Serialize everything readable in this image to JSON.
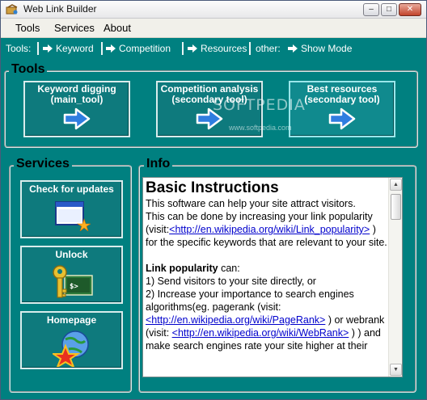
{
  "window": {
    "title": "Web Link Builder",
    "controls": {
      "minimize": "–",
      "maximize": "□",
      "close": "✕"
    }
  },
  "menu": [
    "Tools",
    "Services",
    "About"
  ],
  "toolbar": {
    "tools_label": "Tools:",
    "keyword": "Keyword",
    "competition": "Competition",
    "resources": "Resources",
    "other_label": "other:",
    "show_mode": "Show Mode"
  },
  "tools_group": {
    "title": "Tools",
    "buttons": [
      {
        "line1": "Keyword digging",
        "line2": "(main_tool)"
      },
      {
        "line1": "Competition analysis",
        "line2": "(secondary tool)"
      },
      {
        "line1": "Best resources",
        "line2": "(secondary tool)"
      }
    ]
  },
  "services_group": {
    "title": "Services",
    "buttons": [
      "Check for updates",
      "Unlock",
      "Homepage"
    ]
  },
  "info_group": {
    "title": "Info",
    "heading": "Basic Instructions",
    "para1_a": "This software can help your site attract visitors.",
    "para1_b": " This can be done by increasing your link popularity (visit:",
    "link1": "<http://en.wikipedia.org/wiki/Link_popularity>",
    "para1_c": " ) for the specific keywords that are relevant to your site.",
    "bold_term": "Link popularity",
    "para2_a": " can:",
    "item1": "1) Send visitors to your site directly, or",
    "item2_a": "2) Increase your importance to search engines algorithms(eg. pagerank (visit: ",
    "link2": "<http://en.wikipedia.org/wiki/PageRank>",
    "item2_b": " ) or webrank (visit: ",
    "link3": "<http://en.wikipedia.org/wiki/WebRank>",
    "item2_c": " ) ) and make search engines rate your site higher at their"
  },
  "watermark": {
    "text": "SOFTPEDIA",
    "sub": "www.softpedia.com"
  },
  "colors": {
    "background": "#008080",
    "button": "#0e7a7d",
    "arrow": "#2f7de0",
    "link": "#0000cc"
  }
}
